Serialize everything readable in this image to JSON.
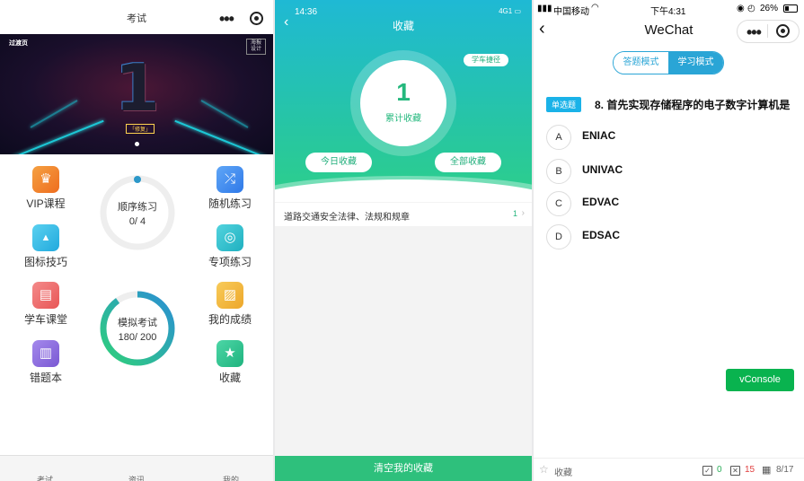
{
  "panel1": {
    "title": "考试",
    "banner": {
      "brand": "过渡页",
      "tag": "海报设计",
      "number": "1",
      "badge": "「修复」"
    },
    "menu": [
      {
        "label": "VIP课程",
        "icon": "crown-icon",
        "color": "#f08a2c"
      },
      {
        "label": "图标技巧",
        "icon": "sign-icon",
        "color": "#2bb8e3"
      },
      {
        "label": "学车课堂",
        "icon": "book-icon",
        "color": "#ef6a6a"
      },
      {
        "label": "错题本",
        "icon": "notebook-icon",
        "color": "#8e6bd9"
      },
      {
        "label": "随机练习",
        "icon": "shuffle-icon",
        "color": "#3e8ef0"
      },
      {
        "label": "专项练习",
        "icon": "target-icon",
        "color": "#27b9c9"
      },
      {
        "label": "我的成绩",
        "icon": "chart-icon",
        "color": "#f2b636"
      },
      {
        "label": "收藏",
        "icon": "star-icon",
        "color": "#27c08e"
      }
    ],
    "sequence": {
      "label": "顺序练习",
      "progress": "0/ 4"
    },
    "exam": {
      "label": "模拟考试",
      "progress": "180/ 200"
    },
    "tabs": [
      "考试",
      "资讯",
      "我的"
    ]
  },
  "panel2": {
    "time": "14:36",
    "signal": "4G1",
    "title": "收藏",
    "tag": "学车捷径",
    "count": "1",
    "count_label": "累计收藏",
    "today_btn": "今日收藏",
    "all_btn": "全部收藏",
    "row_text": "道路交通安全法律、法规和规章",
    "row_count": "1",
    "clear_btn": "清空我的收藏"
  },
  "panel3": {
    "carrier": "中国移动",
    "time": "下午4:31",
    "battery": "26%",
    "nav_title": "WeChat",
    "mode_answer": "答题模式",
    "mode_study": "学习模式",
    "question_type": "单选题",
    "question": "8. 首先实现存储程序的电子数字计算机是",
    "options": [
      {
        "letter": "A",
        "text": "ENIAC"
      },
      {
        "letter": "B",
        "text": "UNIVAC"
      },
      {
        "letter": "C",
        "text": "EDVAC"
      },
      {
        "letter": "D",
        "text": "EDSAC"
      }
    ],
    "vconsole": "vConsole",
    "favorite": "收藏",
    "correct": "0",
    "wrong": "15",
    "page": "8/17"
  }
}
